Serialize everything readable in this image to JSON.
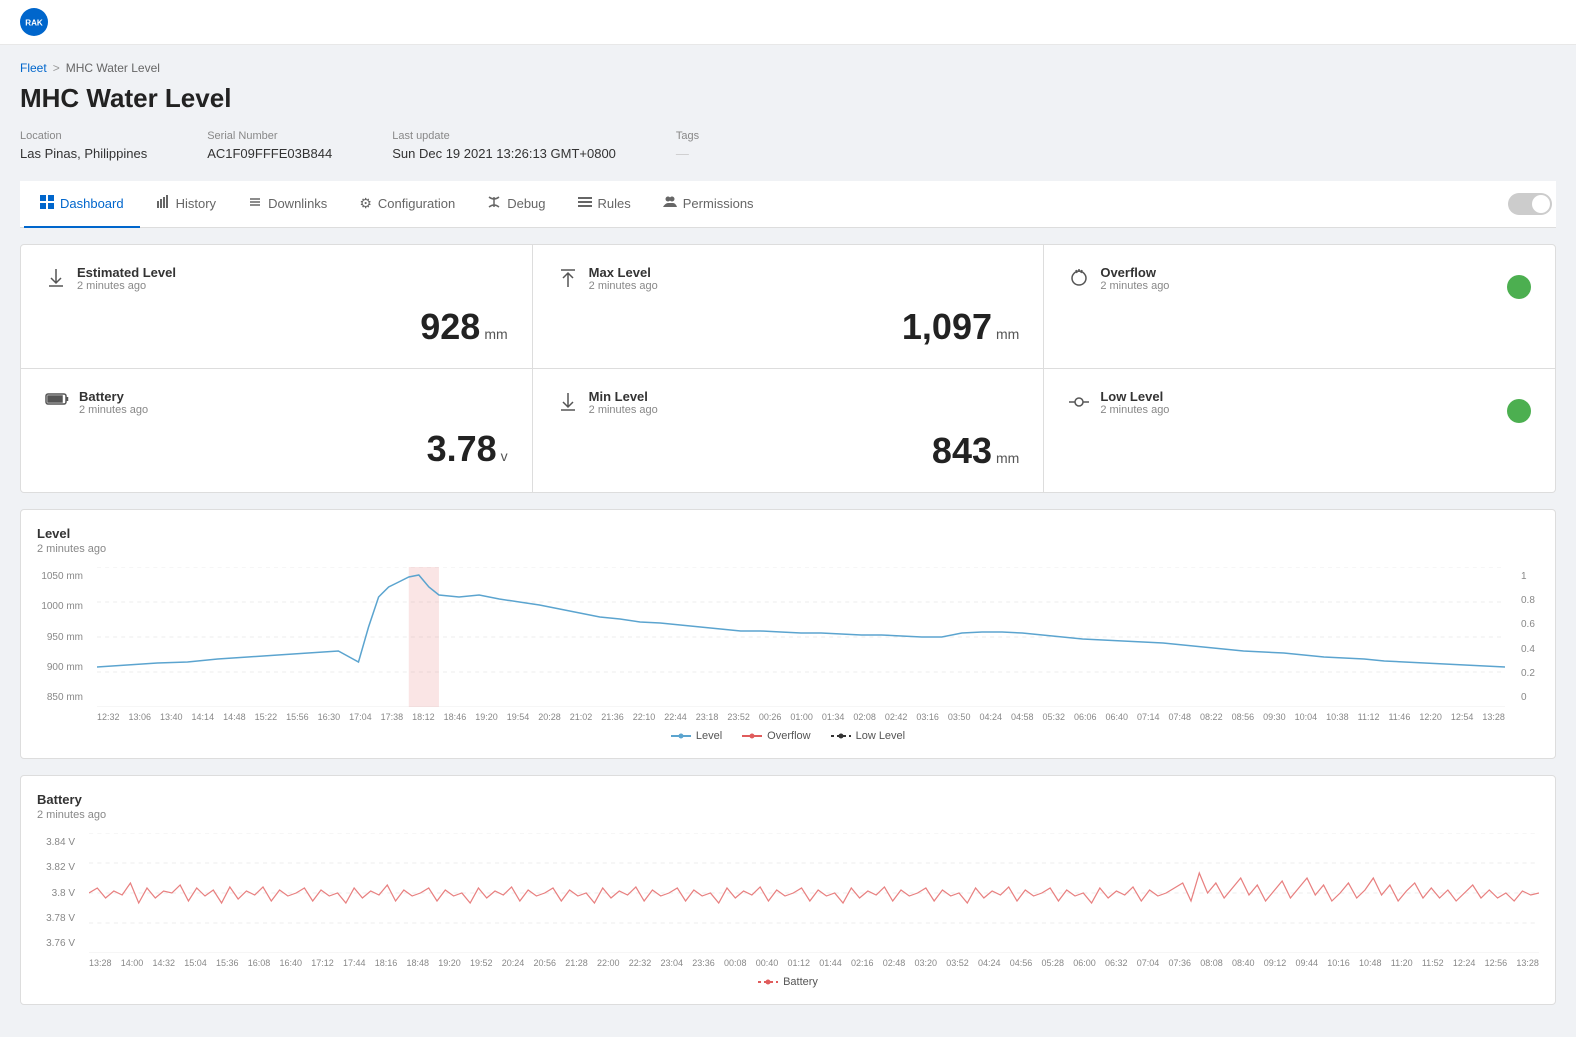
{
  "logo": {
    "text": "RAK"
  },
  "breadcrumb": {
    "parent": "Fleet",
    "current": "MHC Water Level"
  },
  "page": {
    "title": "MHC Water Level"
  },
  "meta": {
    "location_label": "Location",
    "location_value": "Las Pinas, Philippines",
    "serial_label": "Serial Number",
    "serial_value": "AC1F09FFFE03B844",
    "lastupdate_label": "Last update",
    "lastupdate_value": "Sun Dec 19 2021 13:26:13 GMT+0800",
    "tags_label": "Tags",
    "tags_value": "—"
  },
  "tabs": [
    {
      "id": "dashboard",
      "label": "Dashboard",
      "icon": "⊞",
      "active": true
    },
    {
      "id": "history",
      "label": "History",
      "icon": "📊",
      "active": false
    },
    {
      "id": "downlinks",
      "label": "Downlinks",
      "icon": "⇅",
      "active": false
    },
    {
      "id": "configuration",
      "label": "Configuration",
      "icon": "⚙",
      "active": false
    },
    {
      "id": "debug",
      "label": "Debug",
      "icon": "📡",
      "active": false
    },
    {
      "id": "rules",
      "label": "Rules",
      "icon": "☰",
      "active": false
    },
    {
      "id": "permissions",
      "label": "Permissions",
      "icon": "👥",
      "active": false
    }
  ],
  "metrics": [
    {
      "id": "estimated-level",
      "name": "Estimated Level",
      "time": "2 minutes ago",
      "value": "928",
      "unit": "mm",
      "type": "value",
      "icon": "⬇"
    },
    {
      "id": "max-level",
      "name": "Max Level",
      "time": "2 minutes ago",
      "value": "1,097",
      "unit": "mm",
      "type": "value",
      "icon": "⬆"
    },
    {
      "id": "overflow",
      "name": "Overflow",
      "time": "2 minutes ago",
      "value": "",
      "unit": "",
      "type": "dot",
      "dot_color": "#4CAF50",
      "icon": "💧"
    },
    {
      "id": "battery",
      "name": "Battery",
      "time": "2 minutes ago",
      "value": "3.78",
      "unit": "v",
      "type": "value",
      "icon": "🔋"
    },
    {
      "id": "min-level",
      "name": "Min Level",
      "time": "2 minutes ago",
      "value": "843",
      "unit": "mm",
      "type": "value",
      "icon": "⬇"
    },
    {
      "id": "low-level",
      "name": "Low Level",
      "time": "2 minutes ago",
      "value": "",
      "unit": "",
      "type": "dot",
      "dot_color": "#4CAF50",
      "icon": "⊙"
    }
  ],
  "level_chart": {
    "title": "Level",
    "subtitle": "2 minutes ago",
    "y_labels": [
      "1050 mm",
      "1000 mm",
      "950 mm",
      "900 mm",
      "850 mm"
    ],
    "y_labels_right": [
      "1",
      "0.8",
      "0.6",
      "0.4",
      "0.2",
      "0"
    ],
    "x_labels": [
      "12:32",
      "13:06",
      "13:40",
      "14:14",
      "14:48",
      "15:22",
      "15:56",
      "16:30",
      "17:04",
      "17:38",
      "18:12",
      "18:46",
      "19:20",
      "19:54",
      "20:28",
      "21:02",
      "21:36",
      "22:10",
      "22:44",
      "23:18",
      "23:52",
      "00:26",
      "01:00",
      "01:34",
      "02:08",
      "02:42",
      "03:16",
      "03:50",
      "04:24",
      "04:58",
      "05:32",
      "06:06",
      "06:40",
      "07:14",
      "07:48",
      "08:22",
      "08:56",
      "09:30",
      "10:04",
      "10:38",
      "11:12",
      "11:46",
      "12:20",
      "12:54",
      "13:28"
    ],
    "legend": [
      {
        "label": "Level",
        "color": "#5ba4cf",
        "type": "line"
      },
      {
        "label": "Overflow",
        "color": "#e05c5c",
        "type": "line"
      },
      {
        "label": "Low Level",
        "color": "#333",
        "type": "dashed"
      }
    ]
  },
  "battery_chart": {
    "title": "Battery",
    "subtitle": "2 minutes ago",
    "y_labels": [
      "3.84 V",
      "3.82 V",
      "3.8 V",
      "3.78 V",
      "3.76 V"
    ],
    "x_labels": [
      "13:28",
      "14:00",
      "14:32",
      "15:04",
      "15:36",
      "16:08",
      "16:40",
      "17:12",
      "17:44",
      "18:16",
      "18:48",
      "19:20",
      "19:52",
      "20:24",
      "20:56",
      "21:28",
      "22:00",
      "22:32",
      "23:04",
      "23:36",
      "00:08",
      "00:40",
      "01:12",
      "01:44",
      "02:16",
      "02:48",
      "03:20",
      "03:52",
      "04:24",
      "04:56",
      "05:28",
      "06:00",
      "06:32",
      "07:04",
      "07:36",
      "08:08",
      "08:40",
      "09:12",
      "09:44",
      "10:16",
      "10:48",
      "11:20",
      "11:52",
      "12:24",
      "12:56",
      "13:28"
    ],
    "legend": [
      {
        "label": "Battery",
        "color": "#e05c5c",
        "type": "dashed"
      }
    ]
  }
}
